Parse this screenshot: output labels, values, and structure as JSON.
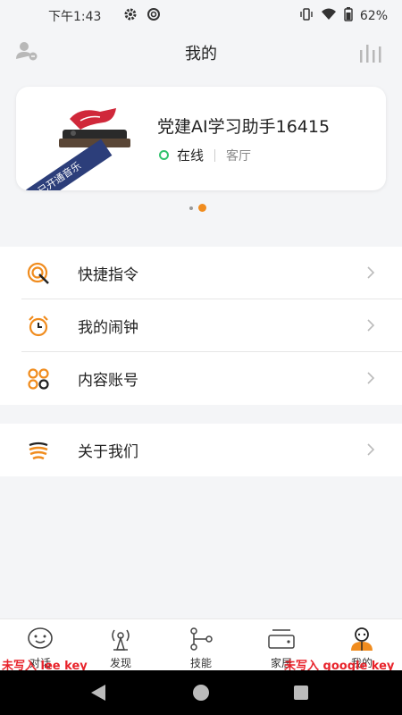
{
  "status_bar": {
    "time": "下午1:43",
    "battery": "62%",
    "icons": [
      "gear-icon",
      "sync-icon",
      "vibrate-icon",
      "wifi-icon",
      "battery-icon"
    ]
  },
  "header": {
    "title": "我的",
    "left_icon": "user-settings-icon",
    "right_icon": "equalizer-icon"
  },
  "device": {
    "name": "党建AI学习助手16415",
    "status": "在线",
    "room": "客厅",
    "badge": "已开通音乐",
    "status_color": "#33c26e"
  },
  "carousel": {
    "pages": 2,
    "active_index": 1,
    "accent": "#f08c1e"
  },
  "menu": {
    "items": [
      {
        "label": "快捷指令",
        "icon": "shortcut-icon"
      },
      {
        "label": "我的闹钟",
        "icon": "alarm-clock-icon"
      },
      {
        "label": "内容账号",
        "icon": "content-account-icon"
      }
    ],
    "about": {
      "label": "关于我们",
      "icon": "bee-icon"
    }
  },
  "tabs": [
    {
      "label": "对话",
      "icon": "chat-icon",
      "active": false
    },
    {
      "label": "发现",
      "icon": "discover-icon",
      "active": false
    },
    {
      "label": "技能",
      "icon": "skills-icon",
      "active": false
    },
    {
      "label": "家居",
      "icon": "home-device-icon",
      "active": false
    },
    {
      "label": "我的",
      "icon": "profile-icon",
      "active": true
    }
  ],
  "toasts": {
    "left": "未写入 lee key",
    "right": "未写入 google key"
  },
  "colors": {
    "accent": "#f08c1e",
    "ribbon": "#2c3e7a",
    "toast": "#e8222a"
  }
}
